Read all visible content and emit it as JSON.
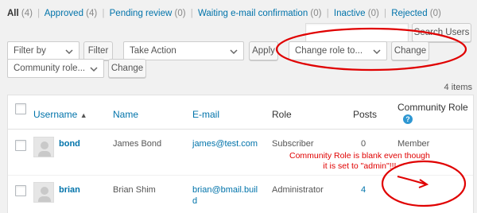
{
  "status_filters": [
    {
      "label": "All",
      "count": "(4)"
    },
    {
      "label": "Approved",
      "count": "(4)"
    },
    {
      "label": "Pending review",
      "count": "(0)"
    },
    {
      "label": "Waiting e-mail confirmation",
      "count": "(0)"
    },
    {
      "label": "Inactive",
      "count": "(0)"
    },
    {
      "label": "Rejected",
      "count": "(0)"
    }
  ],
  "search": {
    "value": "",
    "button_label": "Search Users"
  },
  "toolbar": {
    "filter_select": "Filter by",
    "filter_button": "Filter",
    "action_select": "Take Action",
    "apply_button": "Apply",
    "change_role_select": "Change role to...",
    "change_button": "Change",
    "community_role_select": "Community role...",
    "community_change_button": "Change"
  },
  "items_count": "4 items",
  "table": {
    "columns": [
      "Username",
      "Name",
      "E-mail",
      "Role",
      "Posts",
      "Community Role"
    ],
    "help_icon_text": "?",
    "rows": [
      {
        "username": "bond",
        "name": "James Bond",
        "email": "james@test.com",
        "role": "Subscriber",
        "posts": "0",
        "community_role": "Member"
      },
      {
        "username": "brian",
        "name": "Brian Shim",
        "email_line1": "brian@bmail.buil",
        "email_line2": "d",
        "role": "Administrator",
        "posts": "4",
        "community_role": ""
      }
    ]
  },
  "annotation": {
    "line1": "Community Role is blank even though",
    "line2": "it is set to \"admin\"!!!"
  },
  "colors": {
    "link": "#0073aa",
    "annotation": "#e00000",
    "background": "#f1f1f1"
  }
}
